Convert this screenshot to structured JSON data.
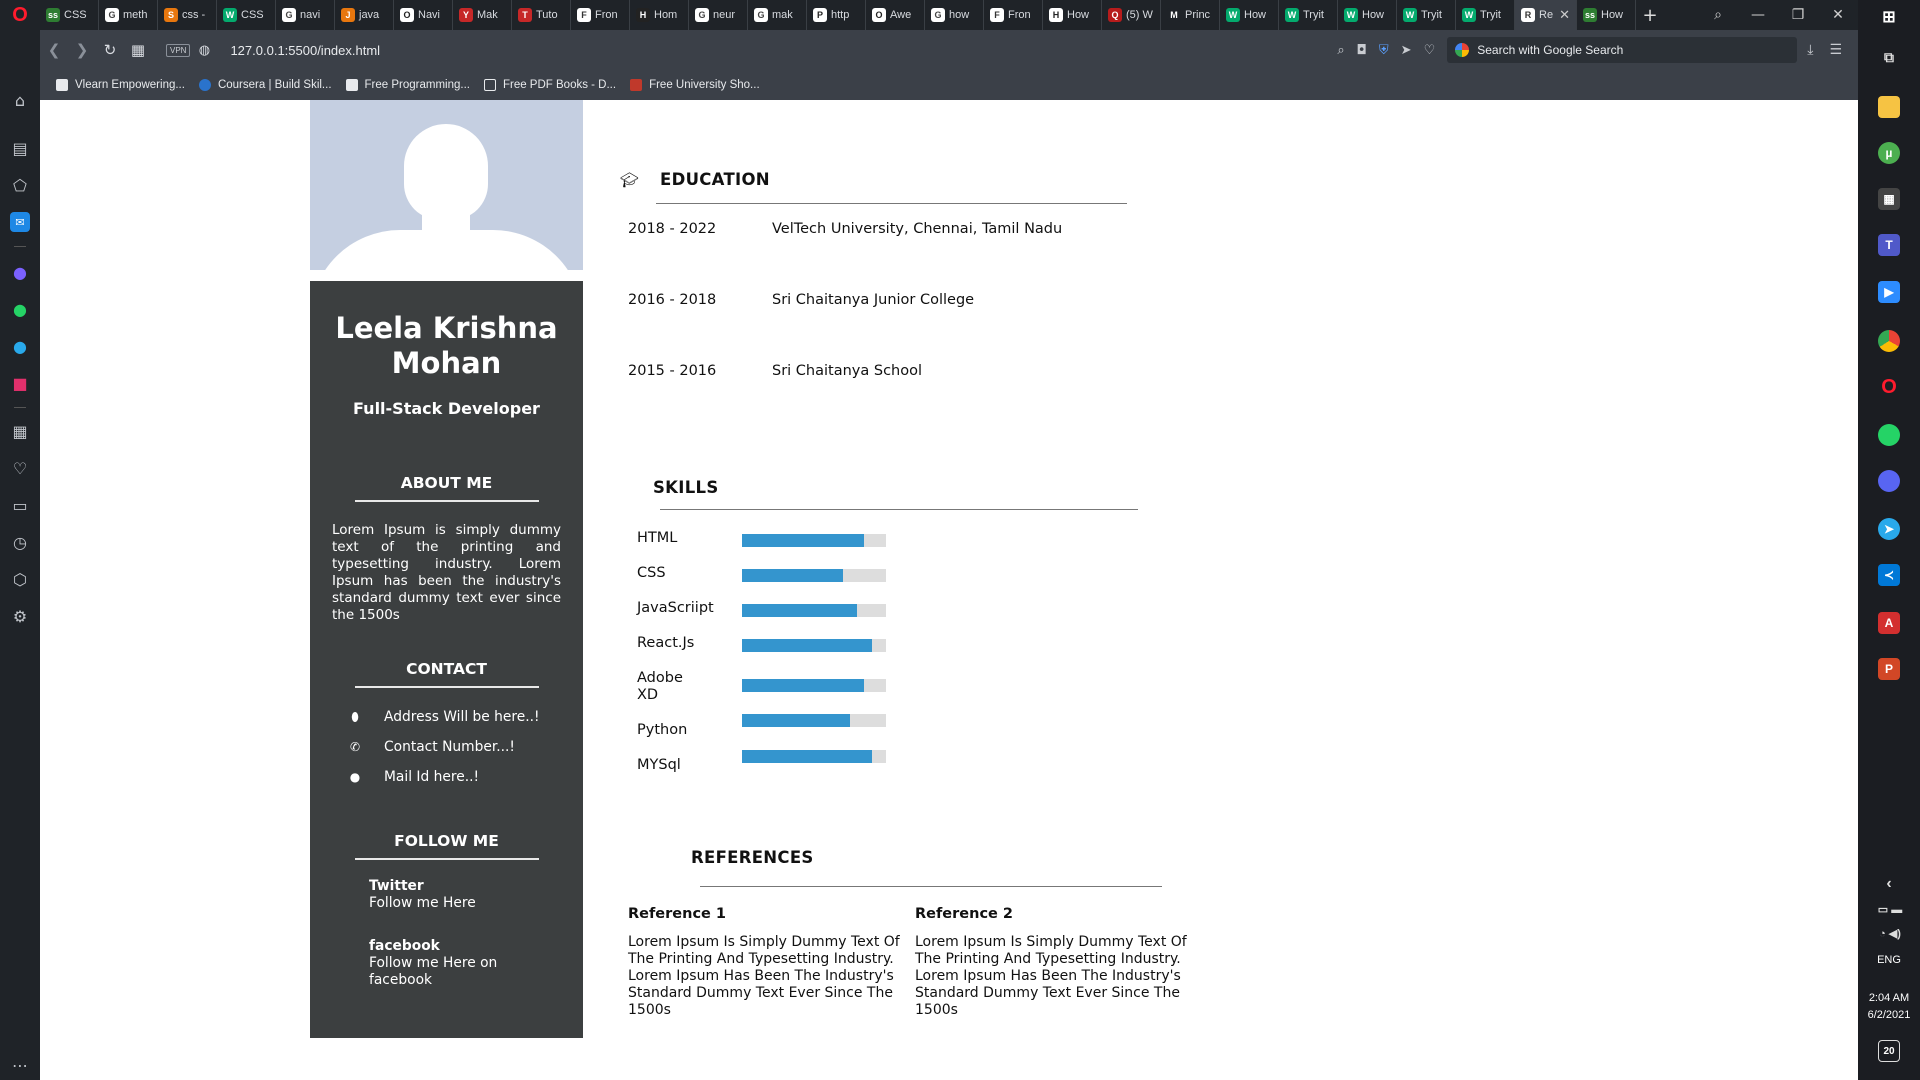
{
  "browser": {
    "tabs": [
      {
        "label": "CSS",
        "icon": "ss"
      },
      {
        "label": "meth",
        "icon": "G"
      },
      {
        "label": "css -",
        "icon": "S"
      },
      {
        "label": "CSS",
        "icon": "W"
      },
      {
        "label": "navi",
        "icon": "G"
      },
      {
        "label": "java",
        "icon": "J"
      },
      {
        "label": "Navi",
        "icon": "O"
      },
      {
        "label": "Mak",
        "icon": "Y"
      },
      {
        "label": "Tuto",
        "icon": "T"
      },
      {
        "label": "Fron",
        "icon": "F"
      },
      {
        "label": "Hom",
        "icon": "H"
      },
      {
        "label": "neur",
        "icon": "G"
      },
      {
        "label": "mak",
        "icon": "G"
      },
      {
        "label": "http",
        "icon": "P"
      },
      {
        "label": "Awe",
        "icon": "O"
      },
      {
        "label": "how",
        "icon": "G"
      },
      {
        "label": "Fron",
        "icon": "F"
      },
      {
        "label": "How",
        "icon": "H"
      },
      {
        "label": "(5) W",
        "icon": "Q"
      },
      {
        "label": "Princ",
        "icon": "M"
      },
      {
        "label": "How",
        "icon": "W"
      },
      {
        "label": "Tryit",
        "icon": "W"
      },
      {
        "label": "How",
        "icon": "W"
      },
      {
        "label": "Tryit",
        "icon": "W"
      },
      {
        "label": "Tryit",
        "icon": "W"
      },
      {
        "label": "Re",
        "icon": "R",
        "active": true
      },
      {
        "label": "How",
        "icon": "ss"
      }
    ],
    "new_tab": "+",
    "url": "127.0.0.1:5500/index.html",
    "vpn_label": "VPN",
    "search_placeholder": "Search with Google Search",
    "bookmarks": [
      {
        "label": "Vlearn Empowering...",
        "color": "#ffffff"
      },
      {
        "label": "Coursera | Build Skil...",
        "color": "#2a73cc"
      },
      {
        "label": "Free Programming...",
        "color": "#ffffff"
      },
      {
        "label": "Free PDF Books - D...",
        "color": "#ffffff"
      },
      {
        "label": "Free University Sho...",
        "color": "#c0392b"
      }
    ]
  },
  "system": {
    "language": "ENG",
    "time": "2:04 AM",
    "date": "6/2/2021",
    "notifications": "20"
  },
  "resume": {
    "name": "Leela Krishna Mohan",
    "role": "Full-Stack Developer",
    "about_title": "ABOUT ME",
    "about_text": "Lorem Ipsum is simply dummy text of the printing and typesetting industry. Lorem Ipsum has been the industry's standard dummy text ever since the 1500s",
    "contact_title": "CONTACT",
    "contact": [
      {
        "icon": "location-icon",
        "text": "Address Will be here..!"
      },
      {
        "icon": "phone-icon",
        "text": "Contact Number...!"
      },
      {
        "icon": "globe-icon",
        "text": "Mail Id here..!"
      }
    ],
    "follow_title": "FOLLOW ME",
    "follow": [
      {
        "name": "Twitter",
        "text": "Follow me Here"
      },
      {
        "name": "facebook",
        "text": "Follow me Here on facebook"
      }
    ],
    "education_title": "EDUCATION",
    "education": [
      {
        "years": "2018 - 2022",
        "school": "VelTech University, Chennai, Tamil Nadu"
      },
      {
        "years": "2016 - 2018",
        "school": "Sri Chaitanya Junior College"
      },
      {
        "years": "2015 - 2016",
        "school": "Sri Chaitanya School"
      }
    ],
    "skills_title": "SKILLS",
    "skills": [
      {
        "name": "HTML",
        "level": 0.85
      },
      {
        "name": "CSS",
        "level": 0.7
      },
      {
        "name": "JavaScriipt",
        "level": 0.8
      },
      {
        "name": "React.Js",
        "level": 0.9
      },
      {
        "name": "Adobe XD",
        "level": 0.85
      },
      {
        "name": "Python",
        "level": 0.75
      },
      {
        "name": "MYSql",
        "level": 0.9
      }
    ],
    "references_title": "REFERENCES",
    "references": [
      {
        "name": "Reference 1",
        "text": "Lorem Ipsum Is Simply Dummy Text Of The Printing And Typesetting Industry. Lorem Ipsum Has Been The Industry's Standard Dummy Text Ever Since The 1500s"
      },
      {
        "name": "Reference 2",
        "text": "Lorem Ipsum Is Simply Dummy Text Of The Printing And Typesetting Industry. Lorem Ipsum Has Been The Industry's Standard Dummy Text Ever Since The 1500s"
      }
    ],
    "colors": {
      "panel": "#3c3f40",
      "photo_bg": "#c5cfe1",
      "skill_bar": "#3495ce",
      "skill_track": "#dddddd"
    }
  }
}
